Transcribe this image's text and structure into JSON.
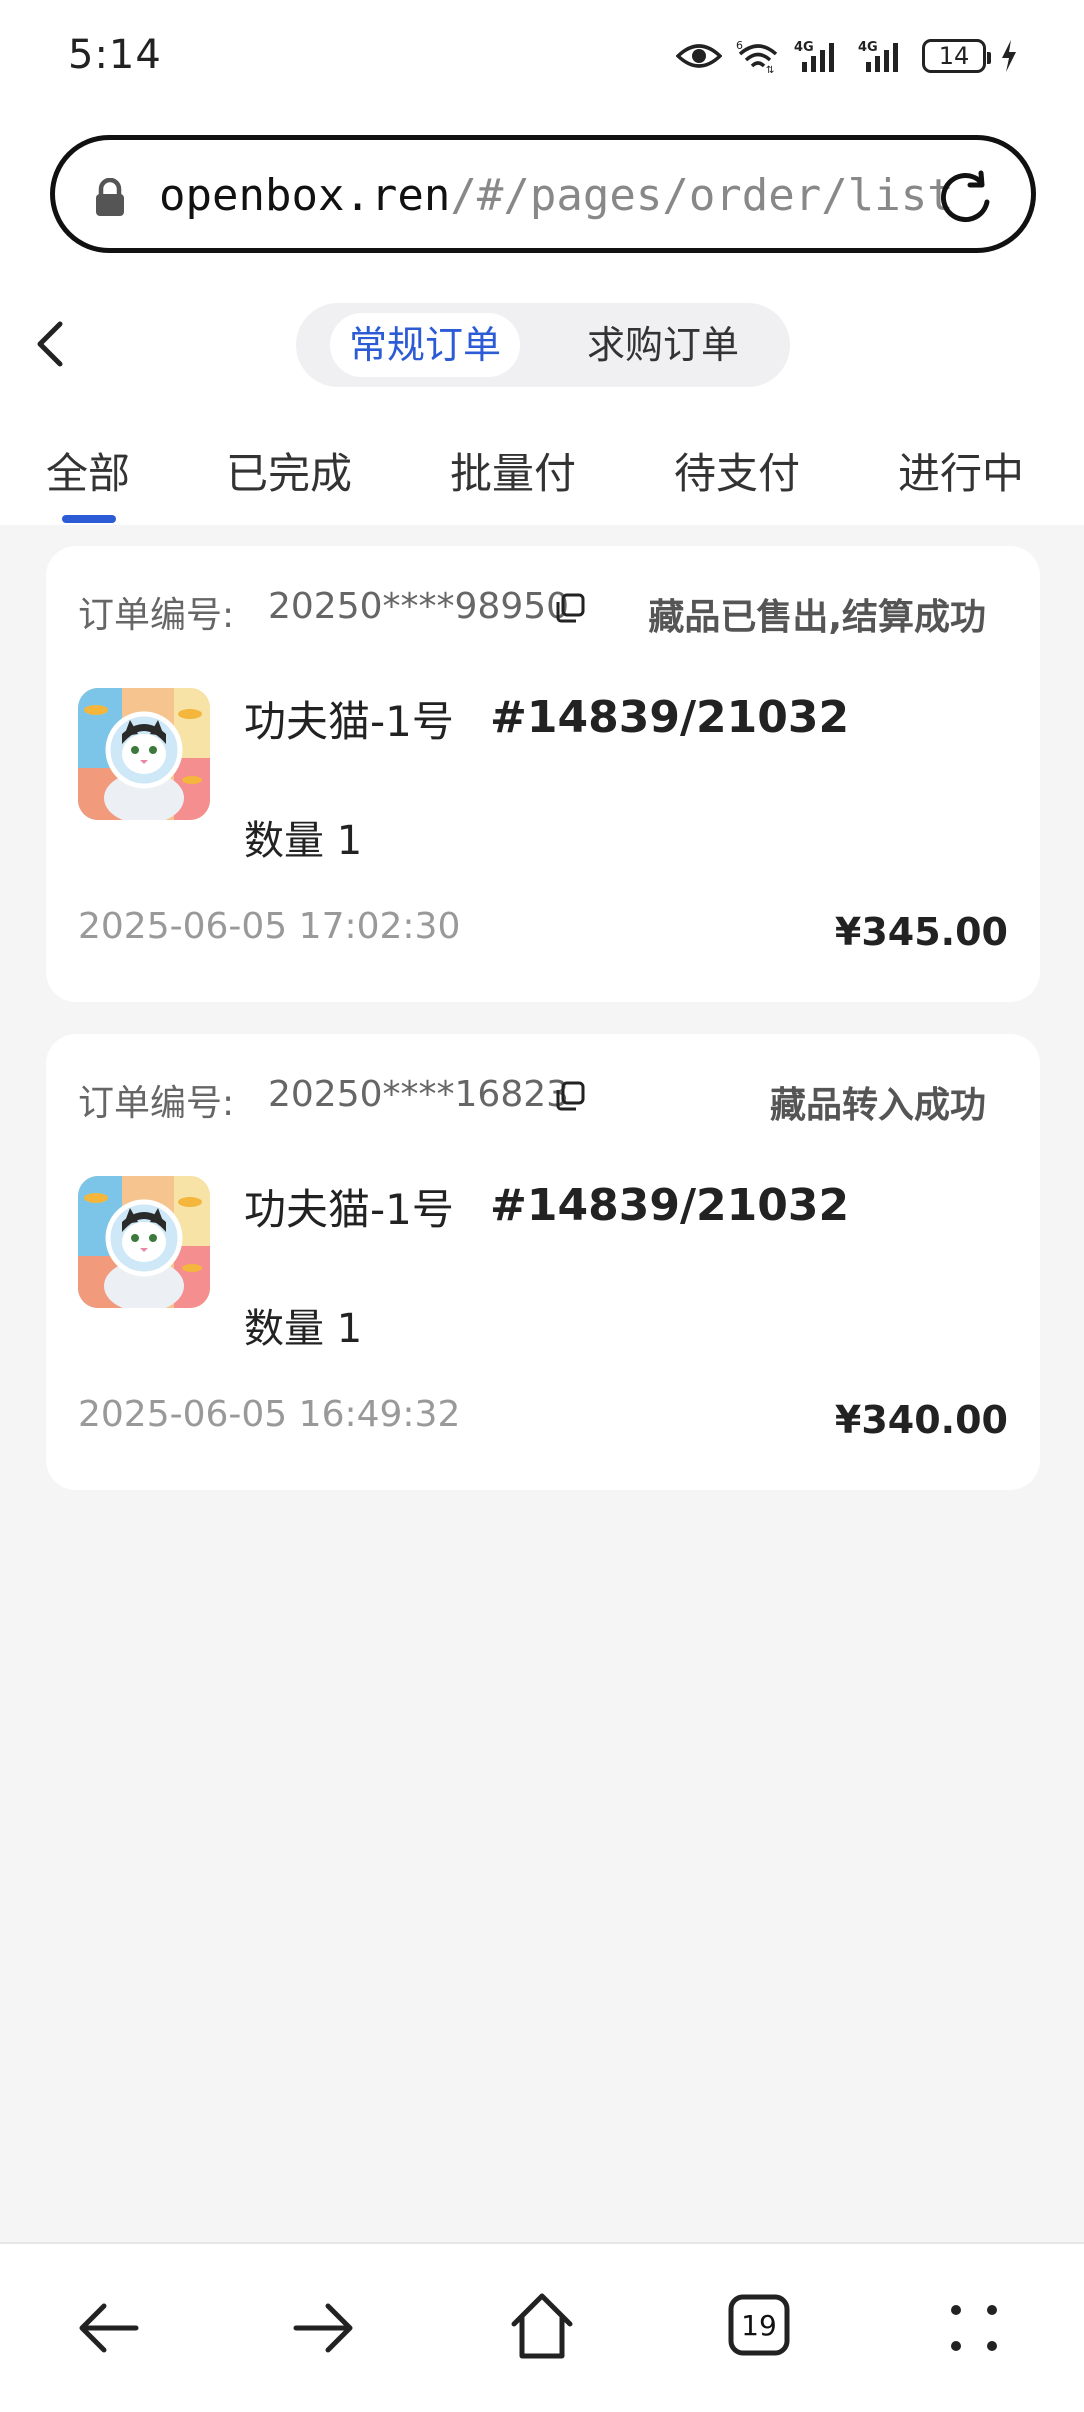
{
  "status_bar": {
    "time": "5:14",
    "battery": "14"
  },
  "browser": {
    "url_host": "openbox.ren",
    "url_path": "/#/pages/order/list",
    "tab_count": "19"
  },
  "header": {
    "segments": [
      "常规订单",
      "求购订单"
    ],
    "active_segment": "常规订单"
  },
  "status_tabs": {
    "items": [
      "全部",
      "已完成",
      "批量付",
      "待支付",
      "进行中"
    ],
    "active": "全部"
  },
  "orders": [
    {
      "order_no_label": "订单编号:",
      "order_no": "20250****98950",
      "status": "藏品已售出,结算成功",
      "item_name": "功夫猫-1号",
      "serial": "#14839/21032",
      "quantity": "数量 1",
      "datetime": "2025-06-05 17:02:30",
      "price": "¥345.00"
    },
    {
      "order_no_label": "订单编号:",
      "order_no": "20250****16823",
      "status": "藏品转入成功",
      "item_name": "功夫猫-1号",
      "serial": "#14839/21032",
      "quantity": "数量 1",
      "datetime": "2025-06-05 16:49:32",
      "price": "¥340.00"
    }
  ],
  "colors": {
    "accent": "#2c5bd6",
    "background": "#f5f5f6",
    "card": "#ffffff"
  },
  "icons": [
    "eye-icon",
    "wifi-icon",
    "signal-4g-icon",
    "battery-icon",
    "charging-icon",
    "lock-icon",
    "reload-icon",
    "back-icon",
    "copy-icon",
    "nav-back-icon",
    "nav-forward-icon",
    "home-icon",
    "tabs-icon",
    "menu-icon"
  ]
}
